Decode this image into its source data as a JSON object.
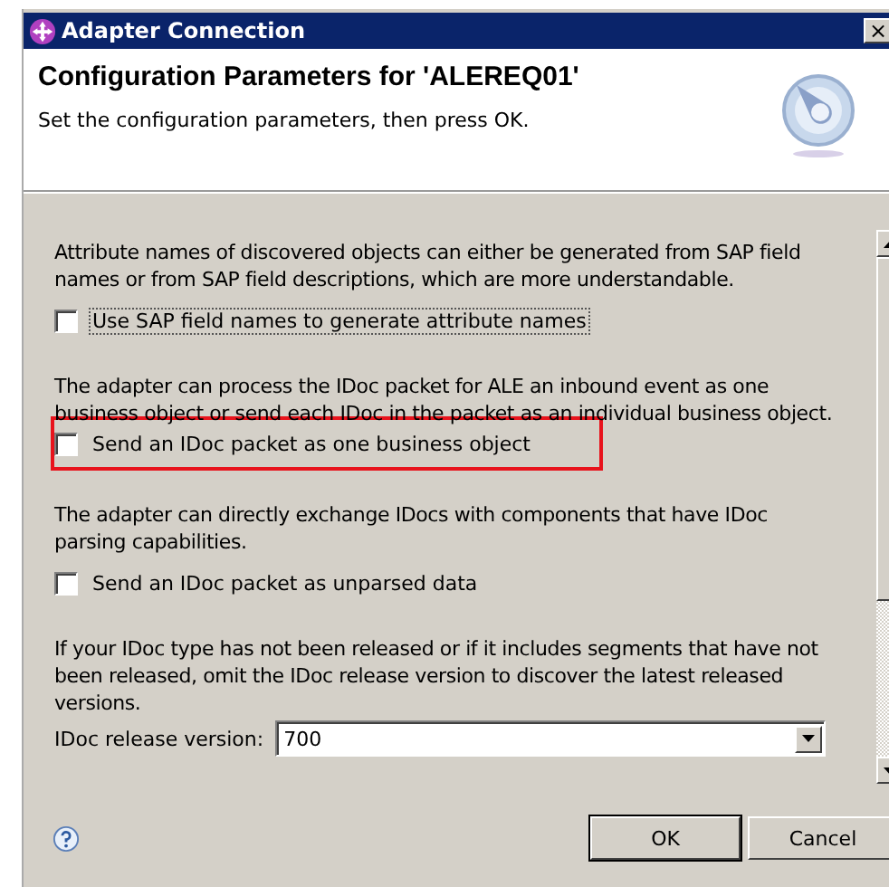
{
  "window": {
    "title": "Adapter Connection",
    "close": "×"
  },
  "header": {
    "title": "Configuration Parameters for 'ALEREQ01'",
    "subtitle": "Set the configuration parameters, then press OK."
  },
  "sections": [
    {
      "description": "Attribute names of discovered objects can either be generated from SAP field\nnames or from SAP field descriptions, which are more understandable.",
      "checkbox": {
        "label": "Use SAP field names to generate attribute names",
        "checked": false,
        "focused": true
      },
      "highlighted": false
    },
    {
      "description": "The adapter can process the IDoc packet for ALE an inbound event as one\nbusiness object or send each IDoc in the packet as an individual business object.",
      "checkbox": {
        "label": "Send an IDoc packet as one business object",
        "checked": false,
        "focused": false
      },
      "highlighted": true
    },
    {
      "description": "The adapter can directly exchange IDocs with components that have IDoc\nparsing capabilities.",
      "checkbox": {
        "label": "Send an IDoc packet as unparsed data",
        "checked": false,
        "focused": false
      },
      "highlighted": false
    },
    {
      "description": "If your IDoc type has not been released or if it includes segments that have not\nbeen released, omit the IDoc release version to discover the latest released\nversions.",
      "field": {
        "label": "IDoc release version:",
        "value": "700"
      },
      "highlighted": false
    }
  ],
  "buttons": [
    {
      "label": "OK",
      "default": true
    },
    {
      "label": "Cancel",
      "default": false
    }
  ]
}
